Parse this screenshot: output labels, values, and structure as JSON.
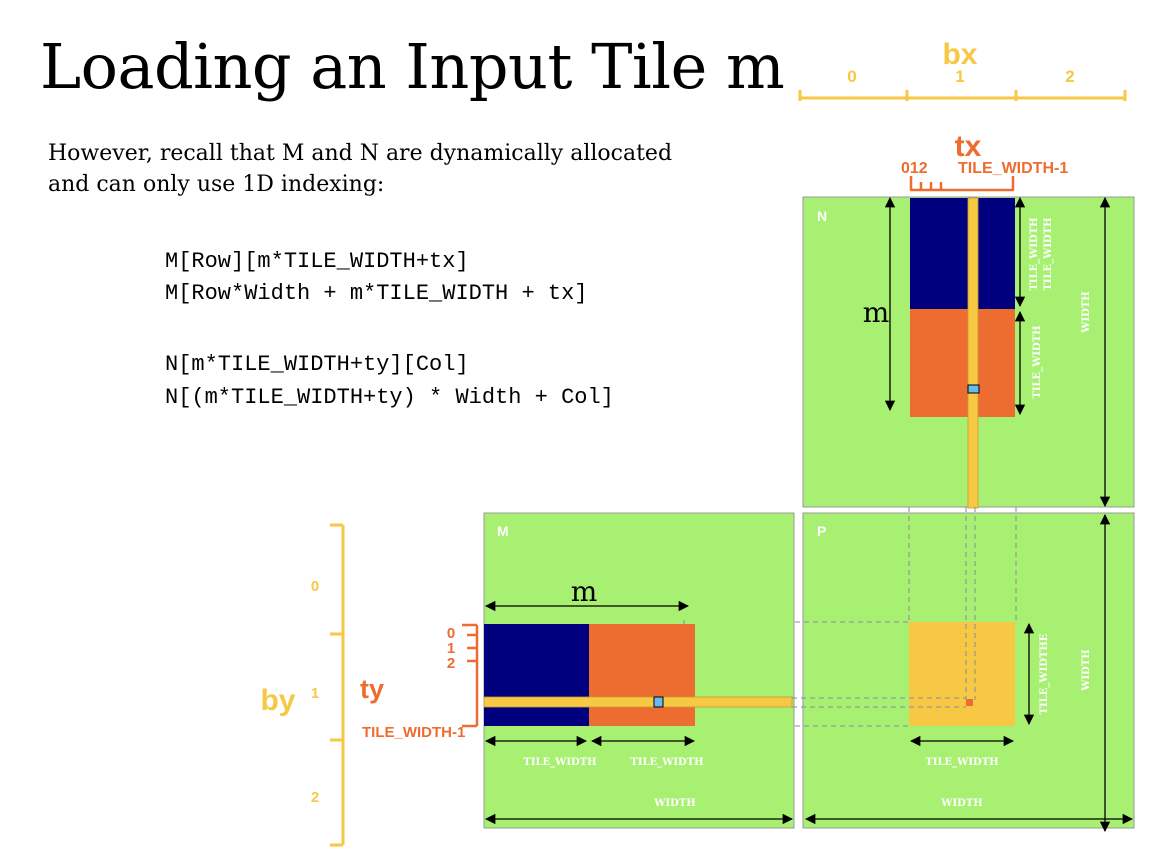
{
  "title": "Loading an Input Tile m",
  "intro_line1": "However, recall that M and N are dynamically allocated",
  "intro_line2": "and can only use 1D indexing:",
  "code": [
    "M[Row][m*TILE_WIDTH+tx]",
    "M[Row*Width + m*TILE_WIDTH + tx]",
    "N[m*TILE_WIDTH+ty][Col]",
    "N[(m*TILE_WIDTH+ty) * Width + Col]"
  ],
  "labels": {
    "bx": "bx",
    "bx_ticks": [
      "0",
      "1",
      "2"
    ],
    "tx": "tx",
    "tx_ticks": "012",
    "tx_last": "TILE_WIDTH-1",
    "by": "by",
    "by_ticks": [
      "0",
      "1",
      "2"
    ],
    "ty": "ty",
    "ty_ticks": [
      "0",
      "1",
      "2"
    ],
    "ty_last": "TILE_WIDTH-1",
    "matrix_n": "N",
    "matrix_m": "M",
    "matrix_p": "P",
    "m": "m",
    "tile_width": "TILE_WIDTH",
    "tile_widthe": "TILE_WIDTHE",
    "width": "WIDTH"
  },
  "colors": {
    "green": "#a8f072",
    "navy": "#00007f",
    "orange": "#ec6d2f",
    "yellow": "#f7c844",
    "cyan": "#66bbee"
  }
}
